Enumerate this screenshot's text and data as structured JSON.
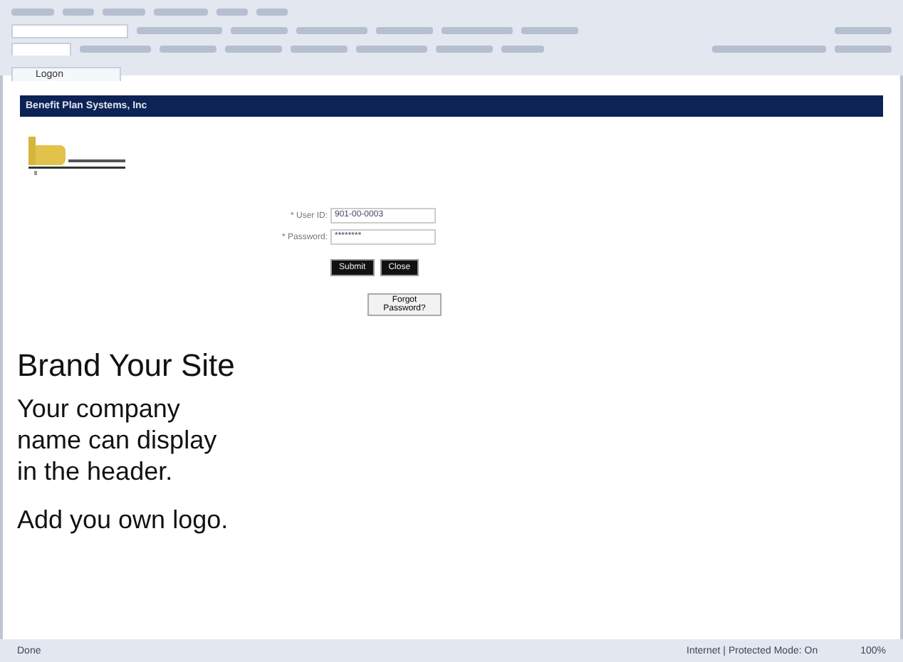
{
  "browser": {
    "tab_title": "Logon",
    "status": "Done",
    "zone": "Internet | Protected Mode: On",
    "zoom": "100%"
  },
  "header": {
    "company": "Benefit Plan Systems, Inc"
  },
  "login": {
    "user_label": "* User ID:",
    "user_value": "901-00-0003",
    "password_label": "* Password:",
    "password_value": "********",
    "buttons": [
      "Submit",
      "Close"
    ],
    "forgot": "Forgot Password?"
  },
  "overlay": {
    "title": "Brand Your Site",
    "lines": [
      "Your company",
      "name can display",
      "in the header."
    ],
    "note": "Add you own logo."
  }
}
